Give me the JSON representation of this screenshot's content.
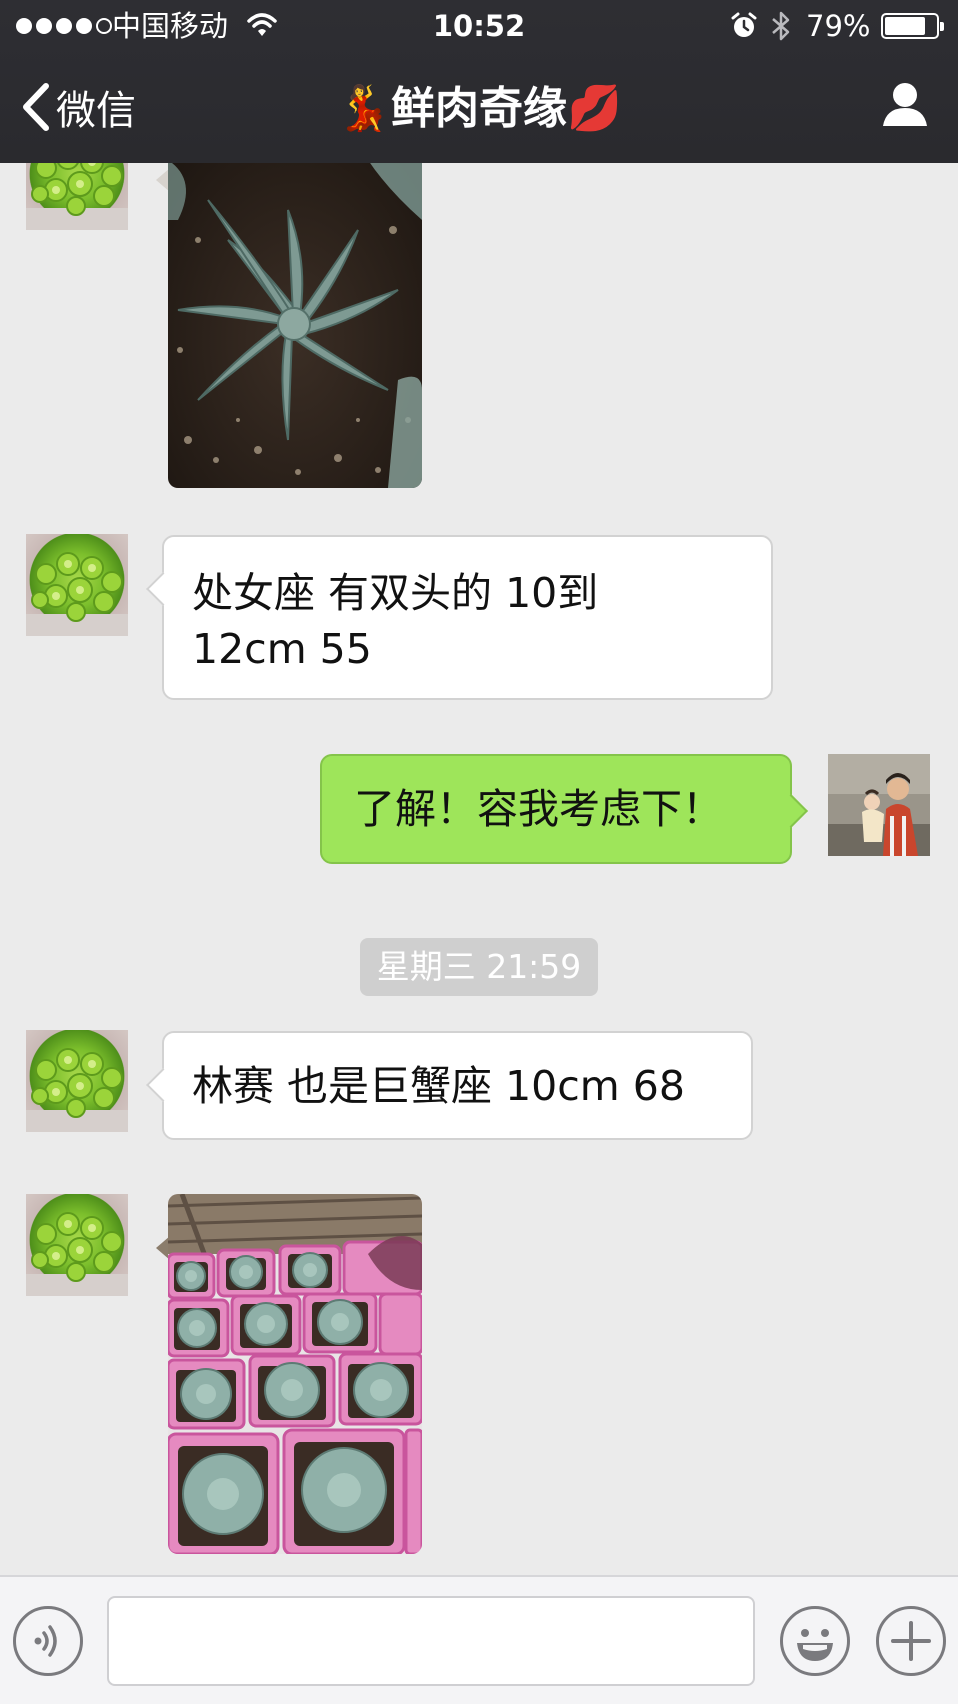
{
  "status_bar": {
    "carrier": "中国移动",
    "time": "10:52",
    "battery": "79%",
    "battery_level": 0.79,
    "signal_dots_filled": 4,
    "signal_dots_total": 5
  },
  "nav": {
    "back_label": "微信",
    "title": "鲜肉奇缘",
    "title_emoji_left": "💃",
    "title_emoji_right": "💋"
  },
  "messages": [
    {
      "id": "m1",
      "side": "left",
      "type": "image",
      "sender": "plant-avatar",
      "image_subject": "succulent-closeup"
    },
    {
      "id": "m2",
      "side": "left",
      "type": "text",
      "sender": "plant-avatar",
      "lines": [
        "处女座 有双头的 10到",
        "12cm 55"
      ]
    },
    {
      "id": "m3",
      "side": "right",
      "type": "text",
      "sender": "self",
      "text": "了解！容我考虑下！"
    },
    {
      "id": "m4",
      "side": "left",
      "type": "text",
      "sender": "plant-avatar",
      "text": "林赛 也是巨蟹座 10cm 68"
    },
    {
      "id": "m5",
      "side": "left",
      "type": "image",
      "sender": "plant-avatar",
      "image_subject": "succulents-in-pink-pots"
    }
  ],
  "timestamp": "星期三 21:59",
  "input": {
    "value": "",
    "placeholder": ""
  },
  "icons": {
    "back": "chevron-left-icon",
    "profile": "person-icon",
    "voice": "voice-icon",
    "emoji": "smiley-icon",
    "more": "plus-icon",
    "wifi": "wifi-icon",
    "alarm": "alarm-icon",
    "bluetooth": "bluetooth-icon"
  },
  "colors": {
    "nav_background": "#2c2c30",
    "chat_background": "#ebebeb",
    "sent_bubble": "#9ee55a",
    "received_bubble": "#ffffff",
    "timestamp_chip": "#cfcfcf"
  }
}
